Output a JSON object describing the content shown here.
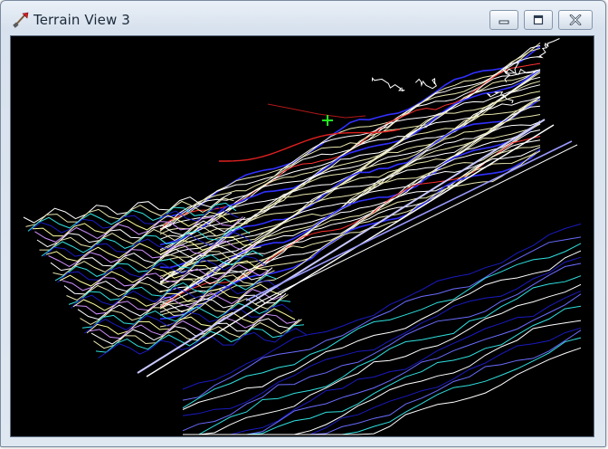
{
  "window": {
    "title": "Terrain View 3",
    "app_icon": "shovel-icon",
    "controls": {
      "minimize_icon": "minimize-icon",
      "maximize_icon": "maximize-icon",
      "close_icon": "close-icon"
    }
  },
  "viewport": {
    "background": "#000000",
    "cursor_icon": "crosshair-icon",
    "cursor_color": "#22ee22",
    "contour_colors": [
      "#ffffff",
      "#e8e6b0",
      "#6a6cff",
      "#1a1ac0",
      "#ff3030",
      "#b01818",
      "#30e0e0",
      "#2ad070",
      "#ffffa0",
      "#d090ff"
    ]
  }
}
